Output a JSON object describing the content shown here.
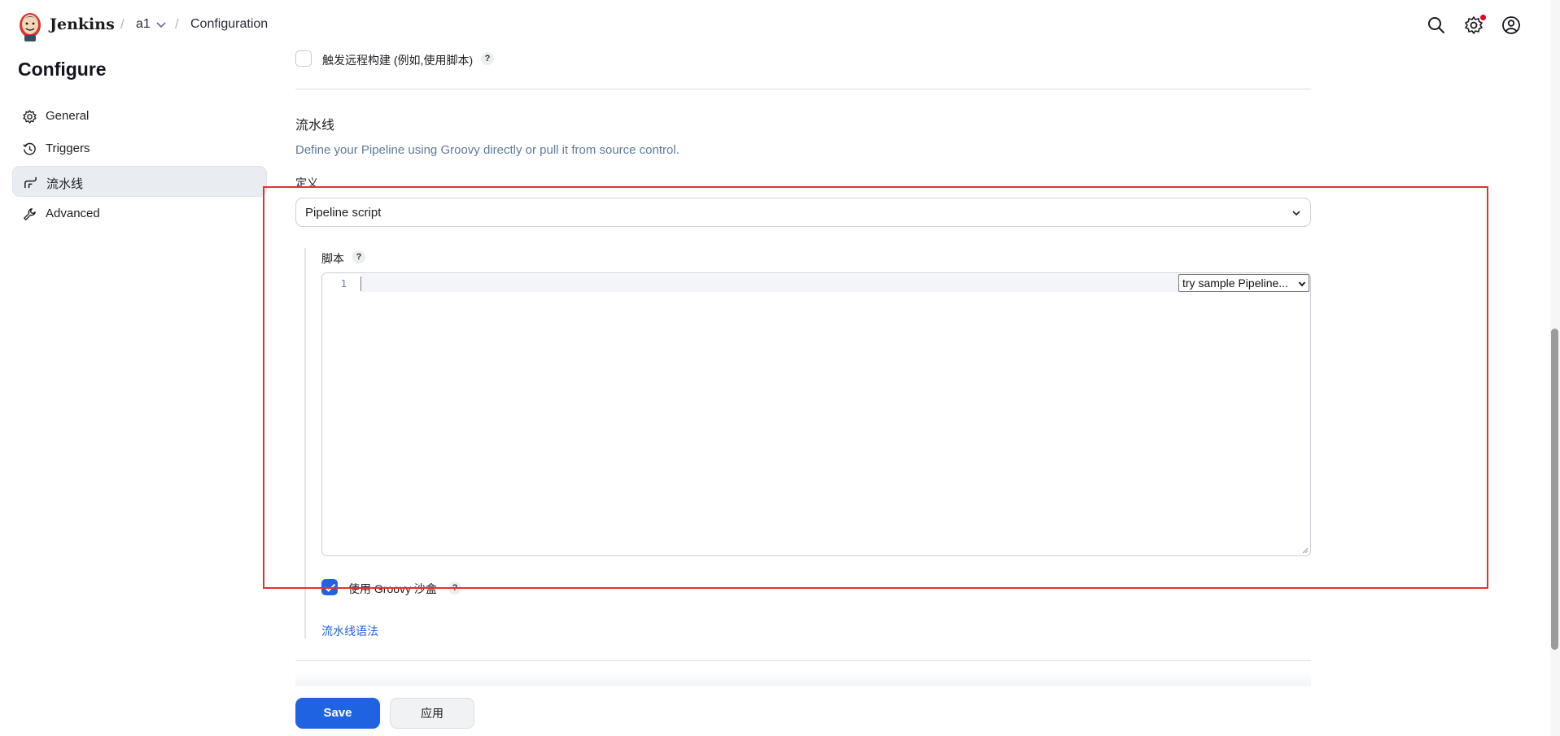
{
  "header": {
    "brand": "Jenkins",
    "breadcrumb": [
      "a1",
      "Configuration"
    ],
    "separator": "/",
    "icons": [
      "search-icon",
      "settings-icon",
      "account-icon"
    ],
    "notification_color": "#e6001f"
  },
  "sidebar": {
    "title": "Configure",
    "items": [
      {
        "label": "General",
        "icon": "gear-icon",
        "active": false
      },
      {
        "label": "Triggers",
        "icon": "clock-icon",
        "active": false
      },
      {
        "label": "流水线",
        "icon": "pipeline-icon",
        "active": true
      },
      {
        "label": "Advanced",
        "icon": "wrench-icon",
        "active": false
      }
    ]
  },
  "main": {
    "trigger_remote": {
      "label": "触发远程构建 (例如,使用脚本)",
      "checked": false,
      "help": "?"
    },
    "pipeline": {
      "title": "流水线",
      "description": "Define your Pipeline using Groovy directly or pull it from source control.",
      "definition_label": "定义",
      "definition_value": "Pipeline script",
      "script_label": "脚本",
      "script_help": "?",
      "line_number": "1",
      "sample_select": "try sample Pipeline...",
      "groovy_sandbox_label": "使用 Groovy 沙盒",
      "groovy_sandbox_checked": true,
      "groovy_sandbox_help": "?",
      "syntax_link": "流水线语法"
    },
    "buttons": {
      "save": "Save",
      "apply": "应用"
    }
  },
  "colors": {
    "accent": "#1f63e2",
    "highlight": "#e8302f"
  }
}
